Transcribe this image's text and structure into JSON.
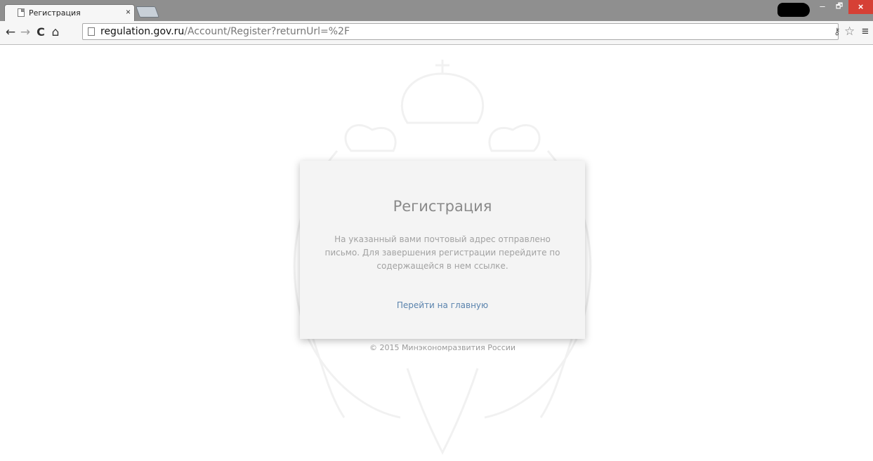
{
  "browser": {
    "tab": {
      "title": "Регистрация",
      "close_glyph": "×"
    },
    "window_controls": {
      "minimize": "–",
      "restore": "🗗",
      "close": "×"
    },
    "nav": {
      "back": "←",
      "forward": "→",
      "reload": "C",
      "home": "⌂"
    },
    "address": {
      "host": "regulation.gov.ru",
      "path": "/Account/Register?returnUrl=%2F"
    },
    "toolbar_icons": {
      "key": "⚷",
      "star": "☆",
      "menu": "≡"
    }
  },
  "page": {
    "card": {
      "title": "Регистрация",
      "message": "На указанный вами почтовый адрес отправлено письмо. Для завершения регистрации перейдите по содержащейся в нем ссылке.",
      "home_link": "Перейти на главную"
    },
    "footer": "© 2015 Минэкономразвития России"
  },
  "colors": {
    "tabstrip": "#8f8f8f",
    "card_bg": "#f4f4f4",
    "link": "#5a83ad",
    "close_button": "#d64035"
  }
}
